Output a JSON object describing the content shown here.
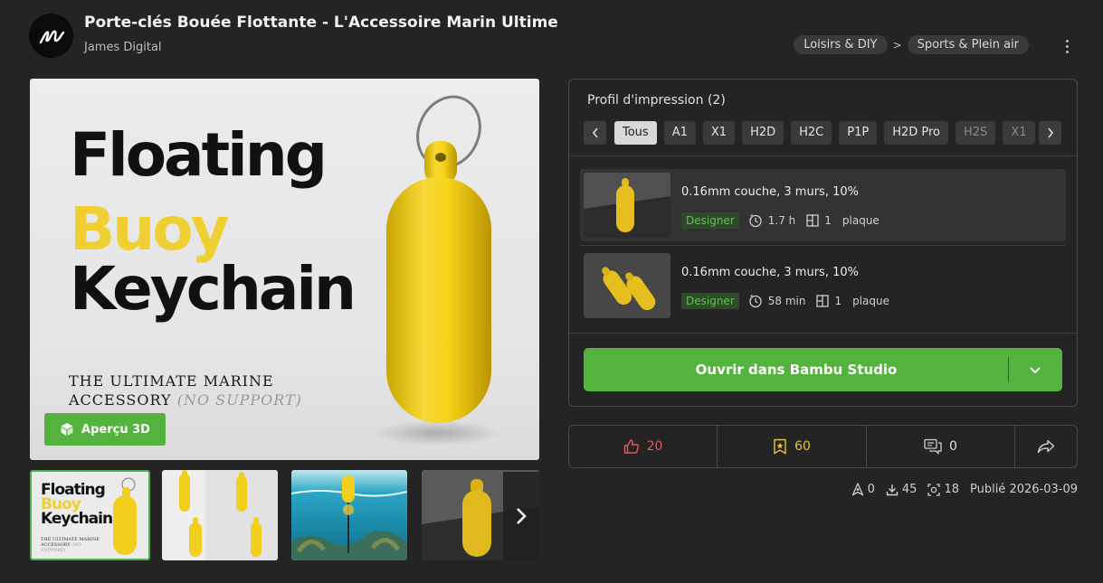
{
  "header": {
    "title": "Porte-clés Bouée Flottante - L'Accessoire Marin Ultime",
    "author": "James Digital",
    "breadcrumbs": [
      "Loisirs & DIY",
      "Sports & Plein air"
    ],
    "breadcrumb_separator": ">"
  },
  "hero": {
    "line1": "Floating",
    "line2": "Buoy",
    "line3": "Keychain",
    "sub1": "THE ULTIMATE MARINE",
    "sub2": "ACCESSORY",
    "sub2_note": "(NO SUPPORT)",
    "preview_button": "Aperçu 3D"
  },
  "thumbnails": {
    "mini_line1": "Floating",
    "mini_line2": "Buoy",
    "mini_line3": "Keychain",
    "mini_sub": "THE ULTIMATE MARINE ACCESSORY",
    "mini_note": "(NO SUPPORT)"
  },
  "profiles": {
    "title": "Profil d'impression (2)",
    "printers": [
      "Tous",
      "A1",
      "X1",
      "H2D",
      "H2C",
      "P1P",
      "H2D Pro",
      "H2S",
      "X1"
    ],
    "active_printer": "Tous",
    "items": [
      {
        "title": "0.16mm couche, 3 murs, 10%",
        "badge": "Designer",
        "time": "1.7 h",
        "plates": "1",
        "plates_label": "plaque"
      },
      {
        "title": "0.16mm couche, 3 murs, 10%",
        "badge": "Designer",
        "time": "58 min",
        "plates": "1",
        "plates_label": "plaque"
      }
    ],
    "open_button": "Ouvrir dans Bambu Studio"
  },
  "stats": {
    "likes": "20",
    "collects": "60",
    "comments": "0"
  },
  "footer": {
    "boosts": "0",
    "downloads": "45",
    "prints": "18",
    "published": "Publié 2026-03-09"
  },
  "colors": {
    "accent_green": "#53b33e",
    "like_red": "#e05a5a",
    "collect_yellow": "#e8c23a",
    "buoy_yellow": "#f2cf1d"
  }
}
